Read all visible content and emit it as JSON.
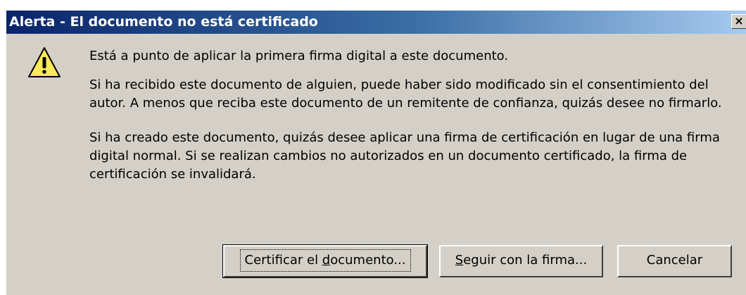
{
  "window": {
    "title": "Alerta - El documento no está certificado",
    "close_label": "×"
  },
  "message": {
    "icon": "warning-triangle-icon",
    "paragraph1": "Está a punto de aplicar la primera firma digital a este documento.",
    "paragraph2": "Si ha recibido este documento de alguien, puede haber sido modificado sin el consentimiento del autor. A menos que reciba este documento de un remitente de confianza, quizás desee no firmarlo.",
    "paragraph3": "Si ha creado este documento, quizás desee aplicar una firma de certificación en lugar de una firma digital normal. Si se realizan cambios no autorizados en un documento certificado, la firma de certificación se invalidará."
  },
  "buttons": {
    "certify_pre": "Certificar el ",
    "certify_mnemonic": "d",
    "certify_post": "ocumento...",
    "continue_mnemonic": "S",
    "continue_post": "eguir con la firma...",
    "cancel": "Cancelar"
  },
  "colors": {
    "dialog_face": "#d4d0c8",
    "title_start": "#0a246a",
    "title_end": "#a6caf0",
    "warning_yellow": "#ffde3b"
  }
}
